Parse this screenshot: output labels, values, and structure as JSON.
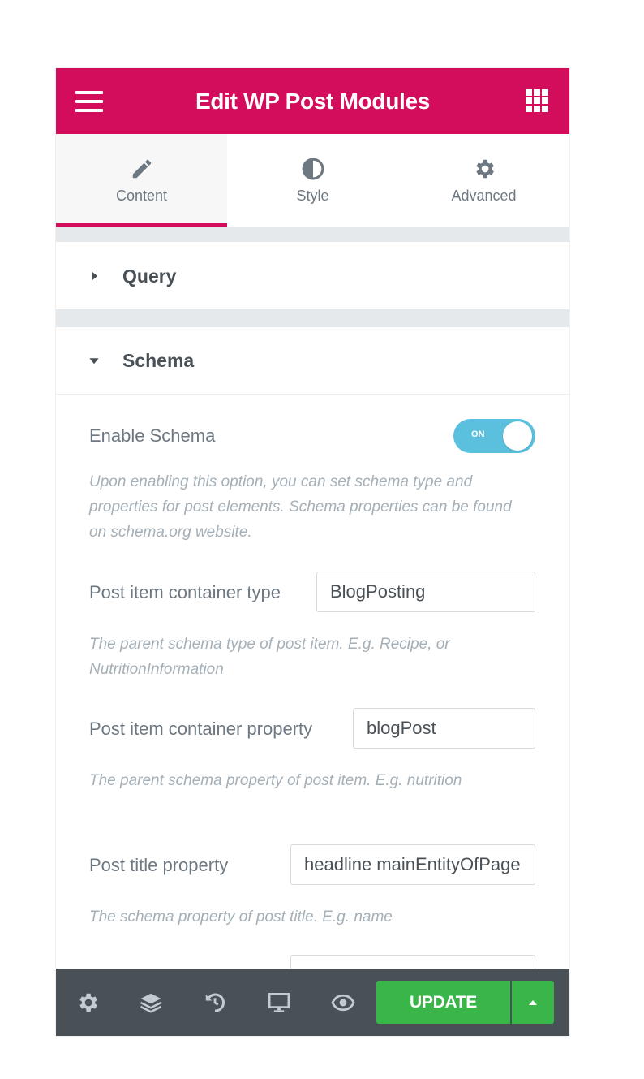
{
  "header": {
    "title": "Edit WP Post Modules"
  },
  "tabs": [
    {
      "label": "Content",
      "icon": "pencil-icon",
      "active": true
    },
    {
      "label": "Style",
      "icon": "half-circle-icon",
      "active": false
    },
    {
      "label": "Advanced",
      "icon": "gear-icon",
      "active": false
    }
  ],
  "sections": {
    "query": {
      "title": "Query",
      "expanded": false
    },
    "schema": {
      "title": "Schema",
      "expanded": true
    }
  },
  "schema": {
    "enable": {
      "label": "Enable Schema",
      "toggle_text": "ON",
      "value": true,
      "description": "Upon enabling this option, you can set schema type and properties for post elements. Schema properties can be found on schema.org website."
    },
    "container_type": {
      "label": "Post item container type",
      "value": "BlogPosting",
      "description": "The parent schema type of post item. E.g. Recipe, or NutritionInformation"
    },
    "container_property": {
      "label": "Post item container property",
      "value": "blogPost",
      "description": "The parent schema property of post item. E.g. nutrition"
    },
    "title_property": {
      "label": "Post title property",
      "value": "headline mainEntityOfPage",
      "description": "The schema property of post title. E.g. name"
    }
  },
  "footer": {
    "update_label": "UPDATE",
    "icons": [
      "gear-icon",
      "layers-icon",
      "history-icon",
      "desktop-icon",
      "eye-icon"
    ]
  },
  "colors": {
    "brand": "#d30c5c",
    "toggle_on": "#5bc0de",
    "update_green": "#39b54a",
    "footer_bg": "#495157"
  }
}
